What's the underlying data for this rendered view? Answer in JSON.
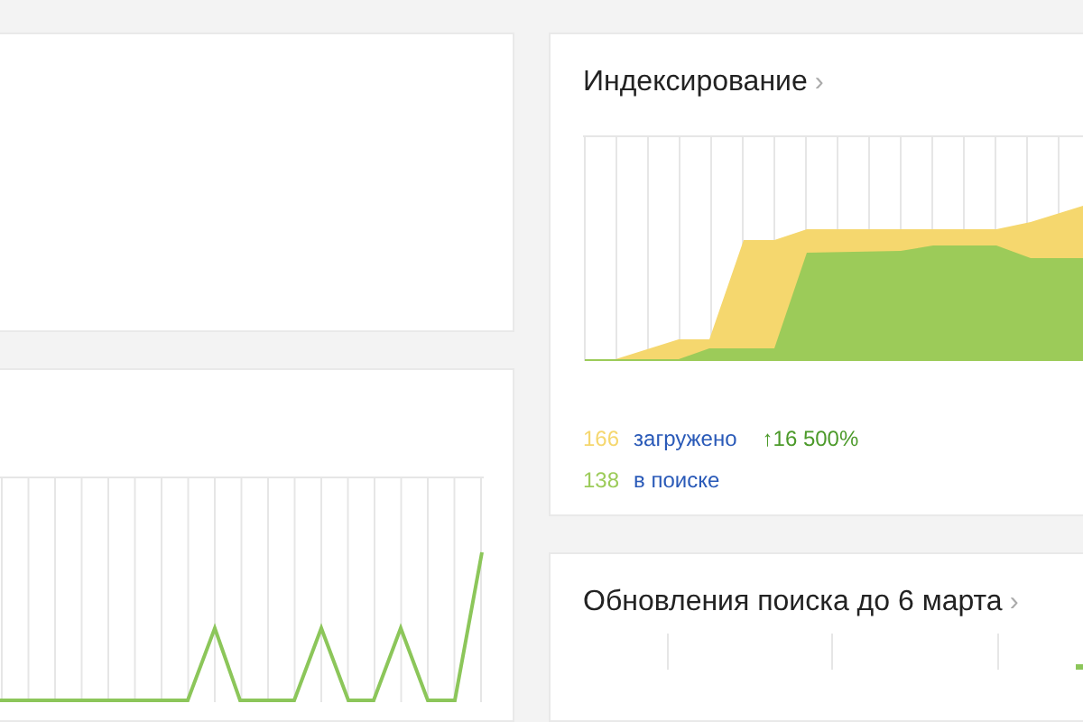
{
  "indexing": {
    "title": "Индексирование",
    "chevron": "›",
    "legend": [
      {
        "value": "166",
        "label": "загружено",
        "change": "↑16 500%",
        "color": "#f5d76e"
      },
      {
        "value": "138",
        "label": "в поиске",
        "color": "#9ccb59"
      }
    ]
  },
  "updates": {
    "title": "Обновления поиска до 6 марта",
    "chevron": "›"
  }
}
